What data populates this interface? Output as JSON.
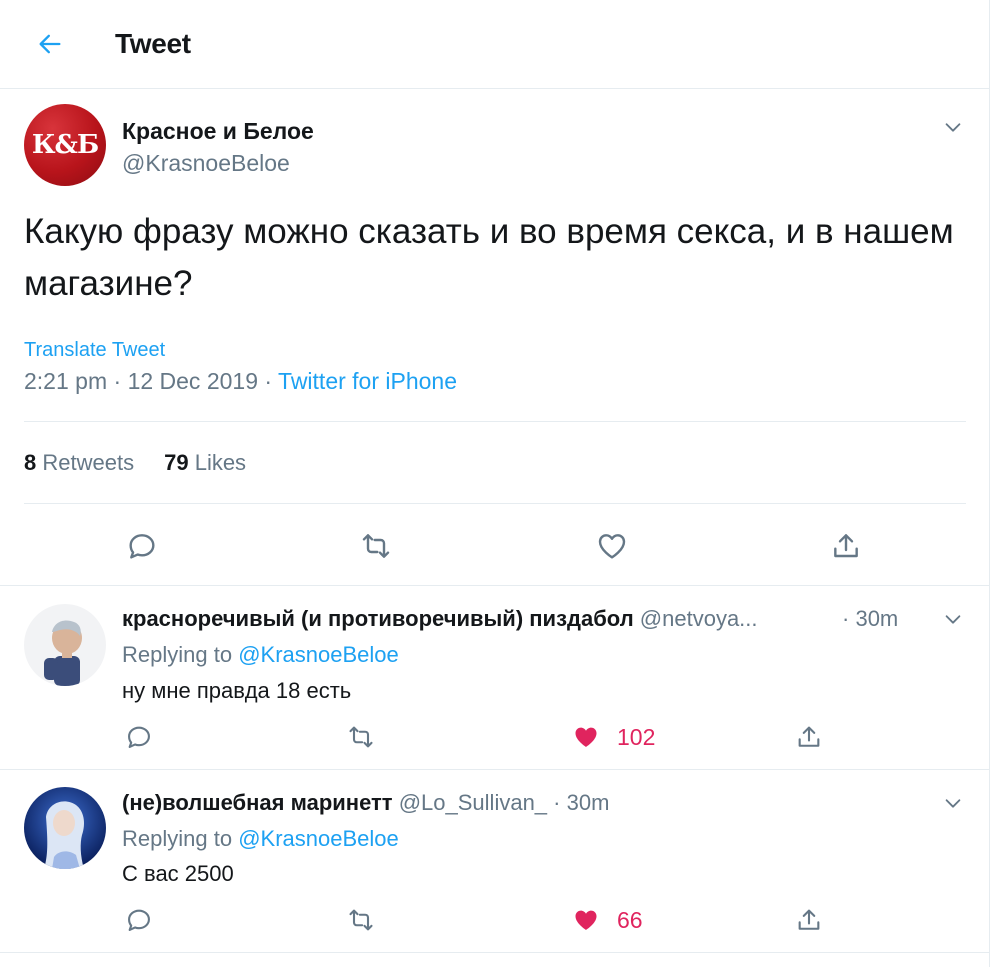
{
  "header": {
    "title": "Tweet",
    "back_icon": "arrow-left-icon"
  },
  "tweet": {
    "avatar_text": "К&Б",
    "name": "Красное и Белое",
    "handle": "@KrasnoeBeloe",
    "text": "Какую фразу можно сказать и во время секса, и в нашем магазине?",
    "translate_label": "Translate Tweet",
    "time": "2:21 pm",
    "date": "12 Dec 2019",
    "separator": "·",
    "source": "Twitter for iPhone",
    "retweets_count": "8",
    "retweets_label": "Retweets",
    "likes_count": "79",
    "likes_label": "Likes"
  },
  "replies": [
    {
      "name": "красноречивый (и противоречивый) пиздабол",
      "handle": "@netvoya...",
      "time": "30m",
      "replying_prefix": "Replying to",
      "replying_to": "@KrasnoeBeloe",
      "text": "ну мне правда 18 есть",
      "likes": "102",
      "liked": true
    },
    {
      "name": "(не)волшебная маринетт",
      "handle": "@Lo_Sullivan_",
      "time": "30m",
      "replying_prefix": "Replying to",
      "replying_to": "@KrasnoeBeloe",
      "text": "С вас 2500",
      "likes": "66",
      "liked": true
    }
  ],
  "colors": {
    "accent": "#1da1f2",
    "muted": "#657786",
    "like": "#e0245e",
    "border": "#e6ecf0",
    "brand": "#b8141b"
  }
}
